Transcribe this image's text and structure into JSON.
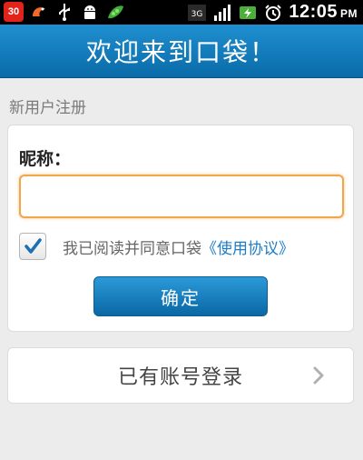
{
  "status_bar": {
    "notification_count": "30",
    "time": "12:05",
    "ampm": "PM",
    "icons": [
      "shrimp-app-icon",
      "usb-icon",
      "android-debug-icon",
      "peapod-app-icon",
      "3g-signal-icon",
      "signal-bars-icon",
      "battery-charging-icon",
      "alarm-clock-icon"
    ]
  },
  "title_bar": {
    "title": "欢迎来到口袋！"
  },
  "register": {
    "section_label": "新用户注册",
    "nickname_label": "昵称：",
    "nickname_value": "",
    "agree_prefix": "我已阅读并同意口袋",
    "agree_link": "《使用协议》",
    "agree_checked": true,
    "confirm_label": "确定"
  },
  "login": {
    "label": "已有账号登录"
  },
  "colors": {
    "accent": "#0a6ba8",
    "input_focus_border": "#f0a64a",
    "link": "#1f7cc6",
    "background": "#ececec"
  }
}
